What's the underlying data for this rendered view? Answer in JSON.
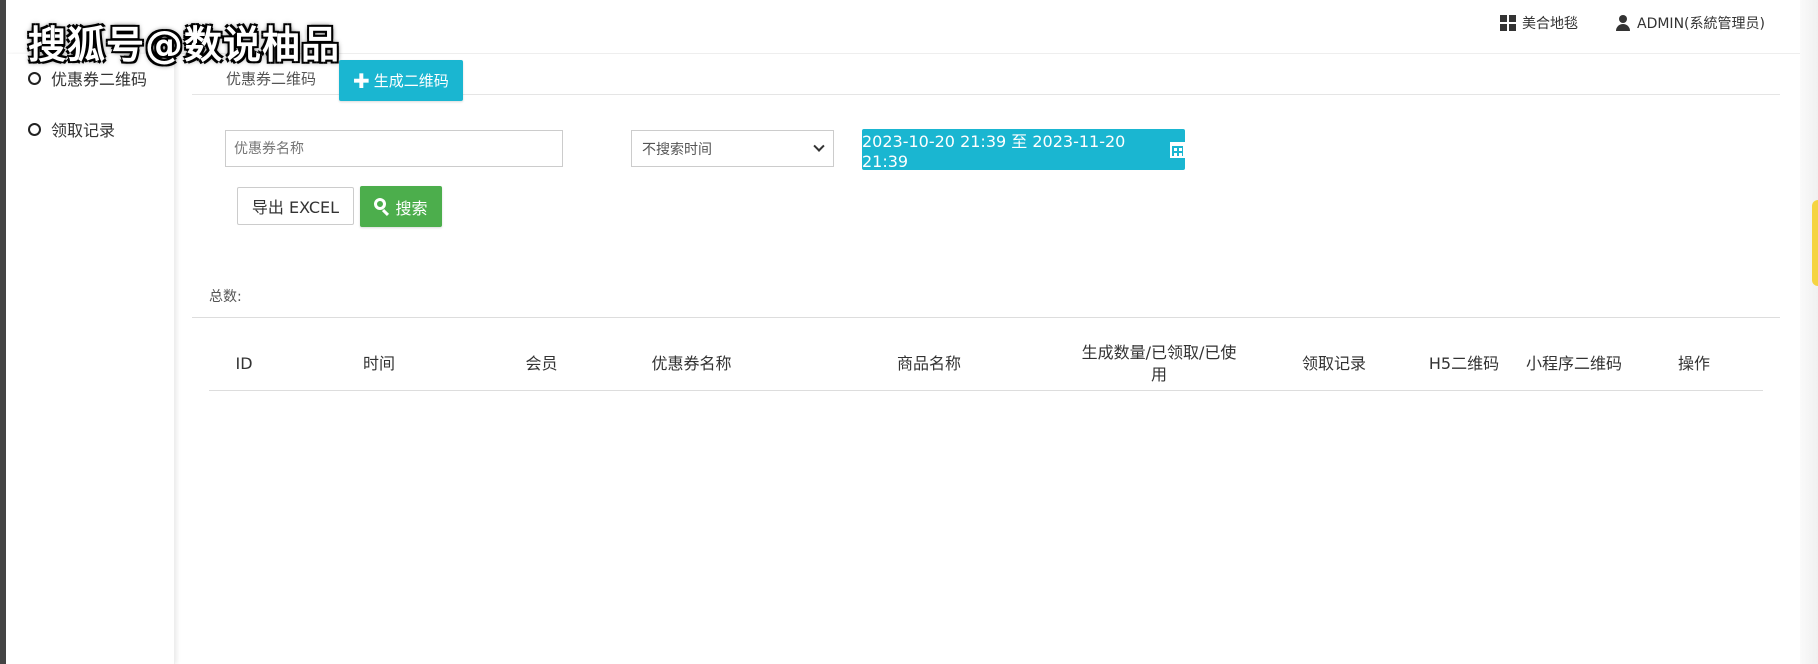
{
  "watermark": "搜狐号@数说柚品",
  "sidebar": {
    "items": [
      {
        "label": "优惠券二维码"
      },
      {
        "label": "领取记录"
      }
    ]
  },
  "header": {
    "store_name": "美合地毯",
    "user": "ADMIN(系統管理员)"
  },
  "tabs": {
    "current": "优惠券二维码",
    "generate_label": "生成二维码"
  },
  "filters": {
    "name_placeholder": "优惠券名称",
    "time_select_value": "不搜索时间",
    "date_range": "2023-10-20 21:39 至 2023-11-20 21:39",
    "export_label": "导出 EXCEL",
    "search_label": "搜索"
  },
  "summary": {
    "total_label": "总数:"
  },
  "table": {
    "columns": [
      "ID",
      "时间",
      "会员",
      "优惠券名称",
      "商品名称",
      "生成数量/已领取/已使用",
      "领取记录",
      "H5二维码",
      "小程序二维码",
      "操作"
    ],
    "rows": []
  },
  "colors": {
    "primary": "#1ab6d1",
    "success": "#4cae4c"
  }
}
